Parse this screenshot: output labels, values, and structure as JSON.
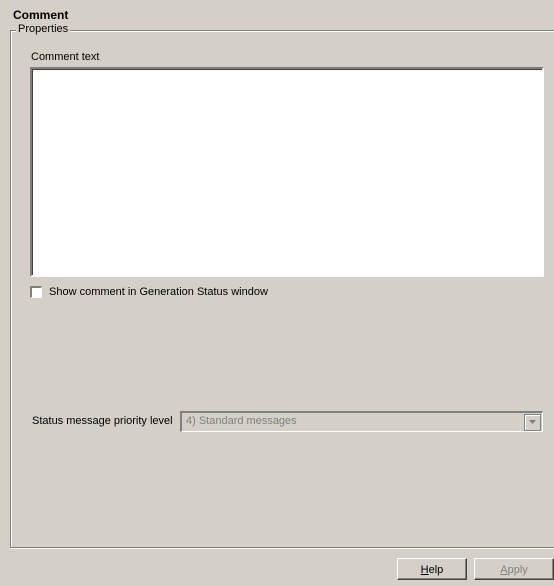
{
  "panel": {
    "title": "Comment"
  },
  "properties": {
    "group_label": "Properties",
    "comment_text_label": "Comment text",
    "comment_text_value": "",
    "show_comment_label": "Show comment in Generation Status window",
    "show_comment_checked": false,
    "priority_label": "Status message priority level",
    "priority_value": "4) Standard messages",
    "priority_enabled": false
  },
  "buttons": {
    "help_mnemonic": "H",
    "help_rest": "elp",
    "apply_mnemonic": "A",
    "apply_rest": "pply",
    "apply_enabled": false
  },
  "icons": {
    "dropdown": "chevron-down-icon"
  }
}
